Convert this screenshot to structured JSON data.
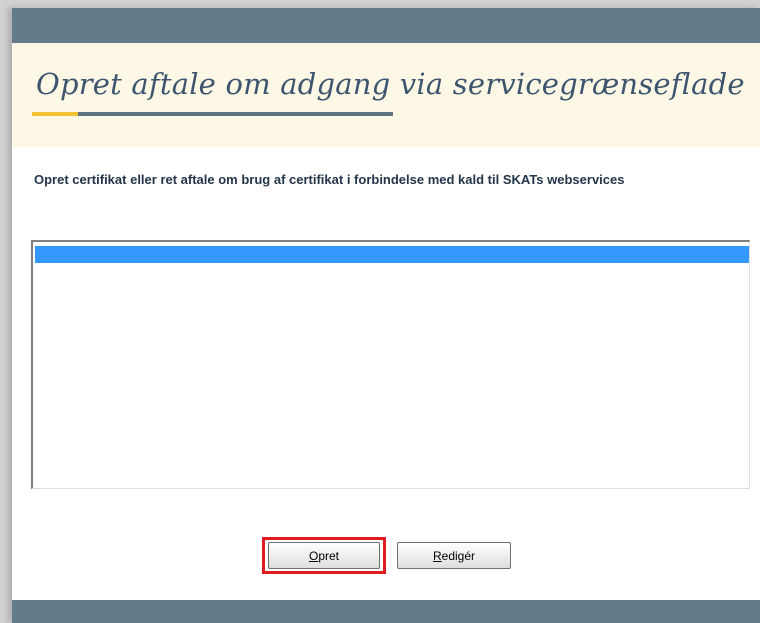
{
  "header": {
    "title": "Opret aftale om adgang via servicegrænseflade"
  },
  "main": {
    "description": "Opret certifikat eller ret aftale om brug af certifikat i forbindelse med kald til SKATs webservices",
    "list": {
      "items": [
        {
          "label": "",
          "selected": true
        }
      ]
    }
  },
  "buttons": {
    "create": {
      "mnemonic": "O",
      "rest": "pret"
    },
    "edit": {
      "mnemonic": "R",
      "rest": "edigér"
    }
  },
  "colors": {
    "header_bar": "#637b8b",
    "title_background": "#fdf8e6",
    "title_text": "#3d556e",
    "title_accent": "#f1c232",
    "selection": "#3399ff",
    "highlight_border": "#e01b24"
  }
}
